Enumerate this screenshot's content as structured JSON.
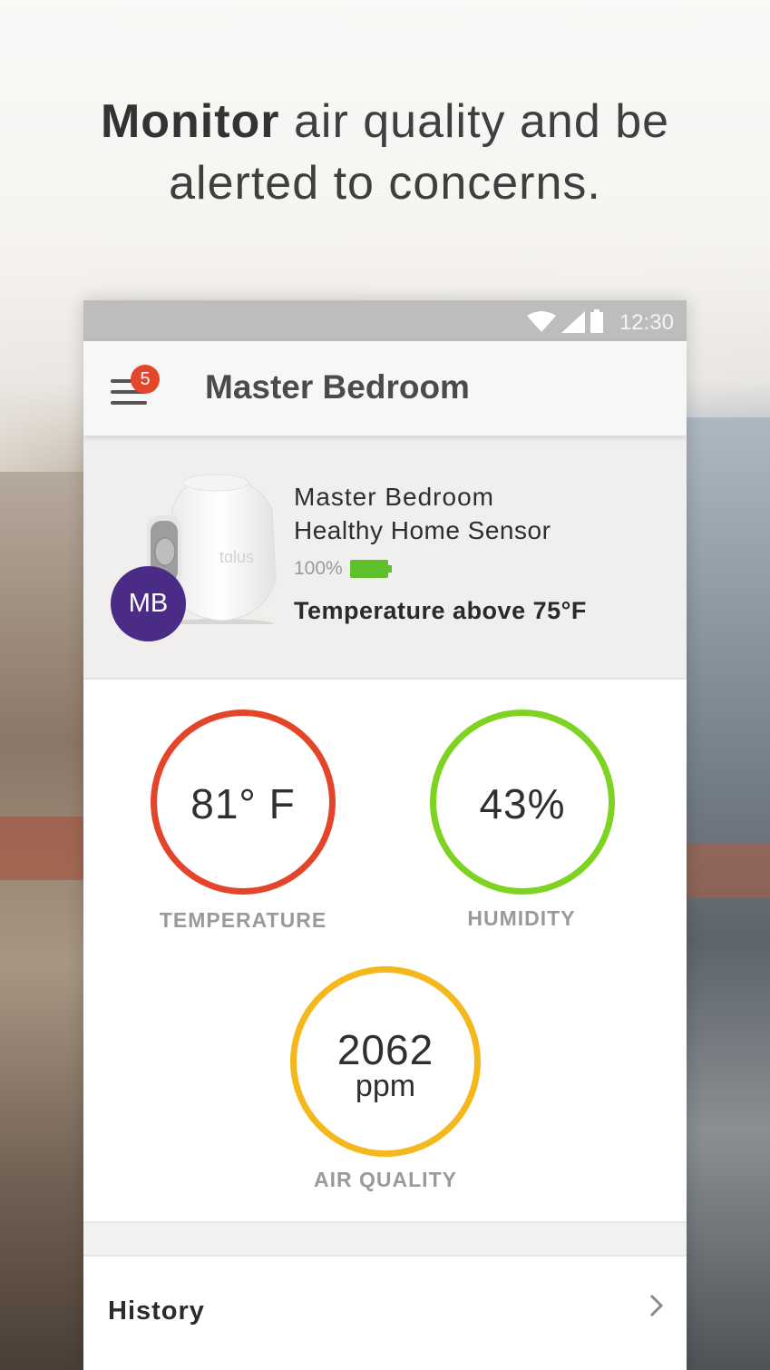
{
  "headline": {
    "bold": "Monitor",
    "rest_line1": " air quality and be",
    "line2": "alerted to concerns."
  },
  "status_bar": {
    "time": "12:30",
    "icons": [
      "wifi-icon",
      "signal-icon",
      "battery-icon"
    ]
  },
  "app_bar": {
    "title": "Master Bedroom",
    "notification_count": "5"
  },
  "sensor": {
    "avatar_initials": "MB",
    "name": "Master Bedroom",
    "type": "Healthy Home Sensor",
    "battery": "100%",
    "alert": "Temperature above 75°F",
    "device_brand": "tɑlus"
  },
  "metrics": {
    "temperature": {
      "value": "81° F",
      "label": "TEMPERATURE",
      "color": "#e4452a"
    },
    "humidity": {
      "value": "43%",
      "label": "HUMIDITY",
      "color": "#7ed321"
    },
    "air_quality": {
      "value": "2062",
      "unit": "ppm",
      "label": "AIR QUALITY",
      "color": "#f5b81c"
    }
  },
  "history": {
    "label": "History"
  }
}
